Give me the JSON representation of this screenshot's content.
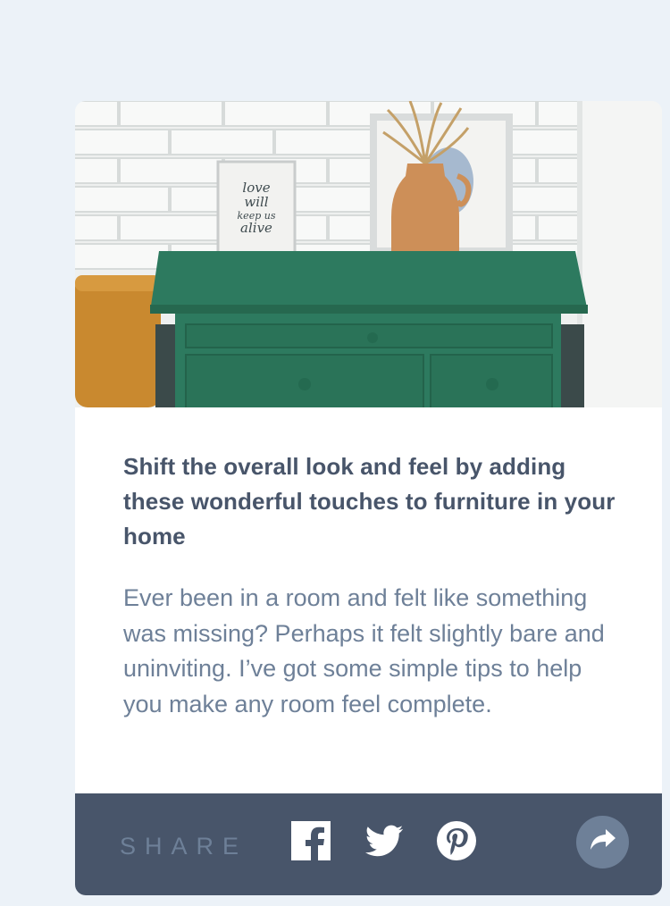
{
  "article": {
    "title": "Shift the overall look and feel by adding these wonderful touches to furniture in your home",
    "excerpt": "Ever been in a room and felt like something was missing? Perhaps it felt slightly bare and uninviting. I’ve got some simple tips to help you make any room feel complete."
  },
  "hero": {
    "frame_text": [
      "love",
      "will",
      "keep us",
      "alive"
    ]
  },
  "share": {
    "label": "SHARE",
    "icons": [
      "facebook-icon",
      "twitter-icon",
      "pinterest-icon",
      "share-arrow-icon"
    ]
  },
  "colors": {
    "page_bg": "#ecf2f8",
    "title": "#48556a",
    "body_text": "#6e8098",
    "share_bar": "#48556a",
    "share_button": "#6e8098",
    "dresser": "#2d7a5f"
  }
}
